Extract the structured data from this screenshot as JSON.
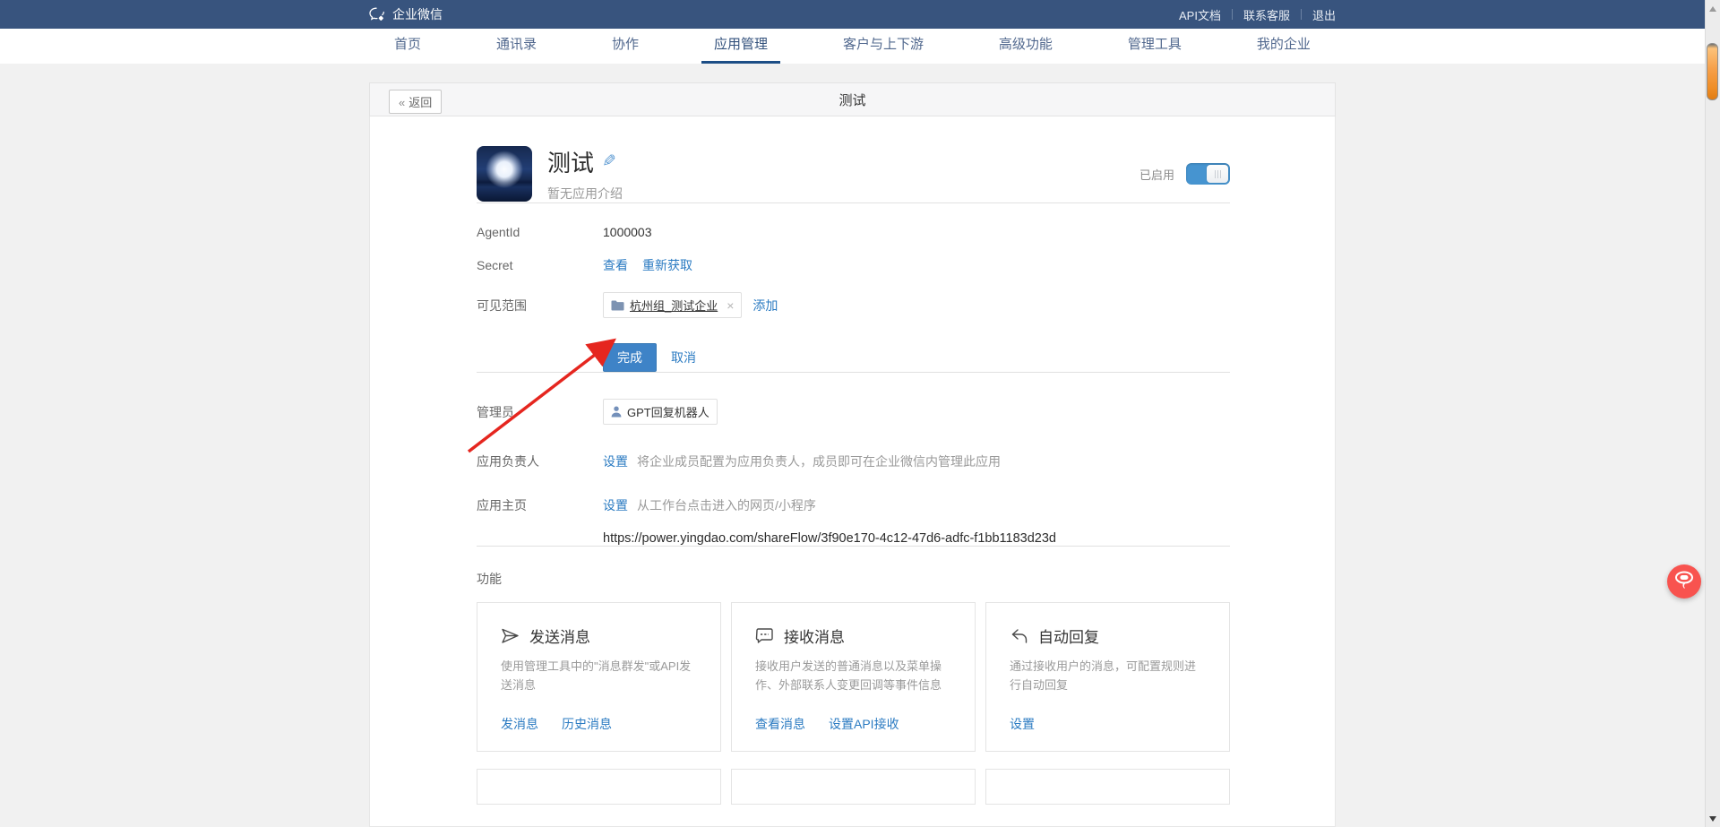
{
  "topbar": {
    "brand": "企业微信",
    "links": [
      "API文档",
      "联系客服",
      "退出"
    ]
  },
  "nav": {
    "items": [
      {
        "label": "首页"
      },
      {
        "label": "通讯录"
      },
      {
        "label": "协作"
      },
      {
        "label": "应用管理",
        "active": true
      },
      {
        "label": "客户与上下游"
      },
      {
        "label": "高级功能"
      },
      {
        "label": "管理工具"
      },
      {
        "label": "我的企业"
      }
    ]
  },
  "header": {
    "back_chevron": "«",
    "back_label": "返回",
    "title": "测试"
  },
  "app": {
    "name": "测试",
    "description": "暂无应用介绍",
    "enabled_label": "已启用"
  },
  "details": {
    "agentid_label": "AgentId",
    "agentid_value": "1000003",
    "secret_label": "Secret",
    "secret_view": "查看",
    "secret_refresh": "重新获取",
    "scope_label": "可见范围",
    "scope_tag": "杭州组_测试企业",
    "scope_remove": "×",
    "scope_add": "添加",
    "done_label": "完成",
    "cancel_label": "取消",
    "admin_label": "管理员",
    "admin_member": "GPT回复机器人",
    "owner_label": "应用负责人",
    "owner_action": "设置",
    "owner_desc": "将企业成员配置为应用负责人，成员即可在企业微信内管理此应用",
    "home_label": "应用主页",
    "home_action": "设置",
    "home_desc": "从工作台点击进入的网页/小程序",
    "home_url": "https://power.yingdao.com/shareFlow/3f90e170-4c12-47d6-adfc-f1bb1183d23d"
  },
  "features": {
    "section_label": "功能",
    "cards": [
      {
        "title": "发送消息",
        "desc": "使用管理工具中的\"消息群发\"或API发送消息",
        "links": [
          "发消息",
          "历史消息"
        ]
      },
      {
        "title": "接收消息",
        "desc": "接收用户发送的普通消息以及菜单操作、外部联系人变更回调等事件信息",
        "links": [
          "查看消息",
          "设置API接收"
        ]
      },
      {
        "title": "自动回复",
        "desc": "通过接收用户的消息，可配置规则进行自动回复",
        "links": [
          "设置"
        ]
      }
    ]
  },
  "icons": {
    "edit": "✎"
  },
  "colors": {
    "topbar_blue": "#38547e",
    "link_blue": "#2b7bc2",
    "primary_button_blue": "#3e83c7",
    "toggle_on_blue": "#4694d0",
    "nav_active_underline": "#1d4e86",
    "annotation_arrow_red": "#e5261f",
    "float_button_red": "#f8534f",
    "scrollbar_thumb_orange": "#f59a3c"
  }
}
